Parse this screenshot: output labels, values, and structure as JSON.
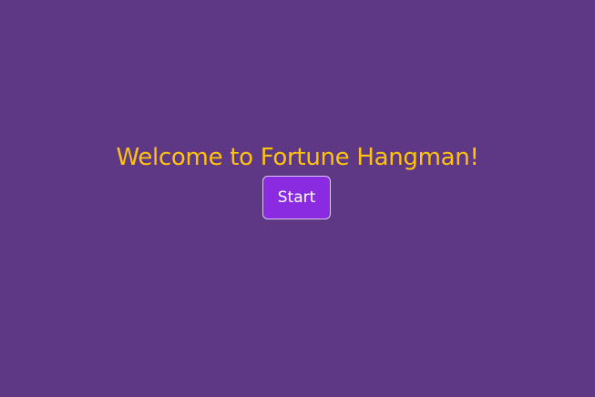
{
  "welcome": {
    "title": "Welcome to Fortune Hangman!",
    "start_label": "Start"
  },
  "colors": {
    "background": "#5e3884",
    "title_text": "#ffc20e",
    "button_background": "#8a2be2",
    "button_border": "#d8c8ee",
    "button_text": "#ffffff"
  }
}
